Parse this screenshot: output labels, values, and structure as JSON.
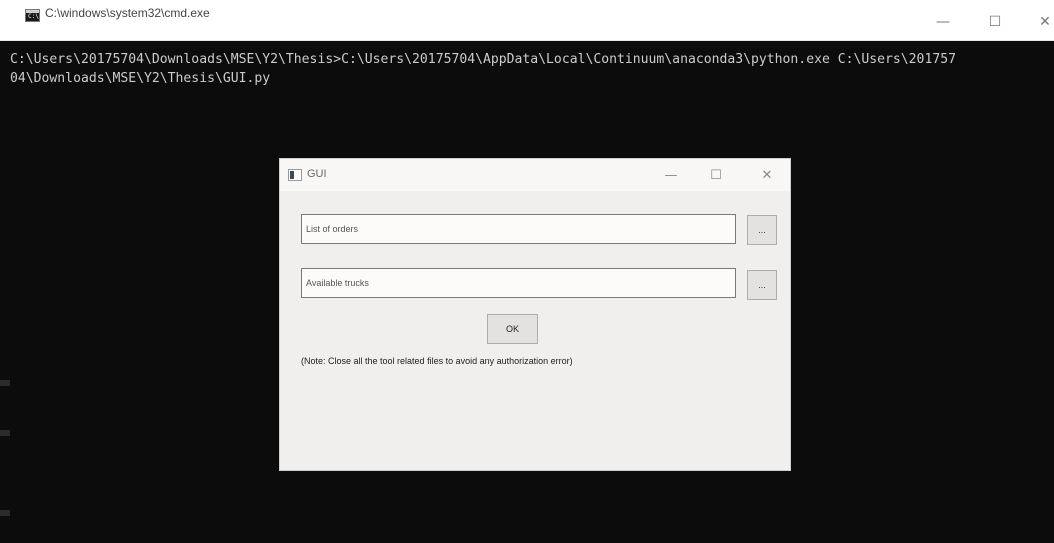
{
  "cmd_window": {
    "title": "C:\\windows\\system32\\cmd.exe",
    "icon": "console-icon",
    "icon_text": "C:\\",
    "controls": {
      "minimize": "—",
      "maximize": "☐",
      "close": "✕"
    },
    "output_lines": [
      "C:\\Users\\20175704\\Downloads\\MSE\\Y2\\Thesis>C:\\Users\\20175704\\AppData\\Local\\Continuum\\anaconda3\\python.exe C:\\Users\\201757",
      "04\\Downloads\\MSE\\Y2\\Thesis\\GUI.py"
    ]
  },
  "gui_window": {
    "title": "GUI",
    "icon": "app-window-icon",
    "controls": {
      "minimize": "—",
      "maximize": "☐",
      "close": "✕"
    },
    "orders_field": {
      "placeholder": "List of orders",
      "value": ""
    },
    "orders_browse_label": "...",
    "trucks_field": {
      "placeholder": "Available trucks",
      "value": ""
    },
    "trucks_browse_label": "...",
    "ok_label": "OK",
    "note": "(Note: Close all the tool related files to avoid any authorization error)"
  },
  "colors": {
    "console_background": "#0c0c0c",
    "console_text": "#cccccc",
    "dialog_background": "#f0efee"
  }
}
